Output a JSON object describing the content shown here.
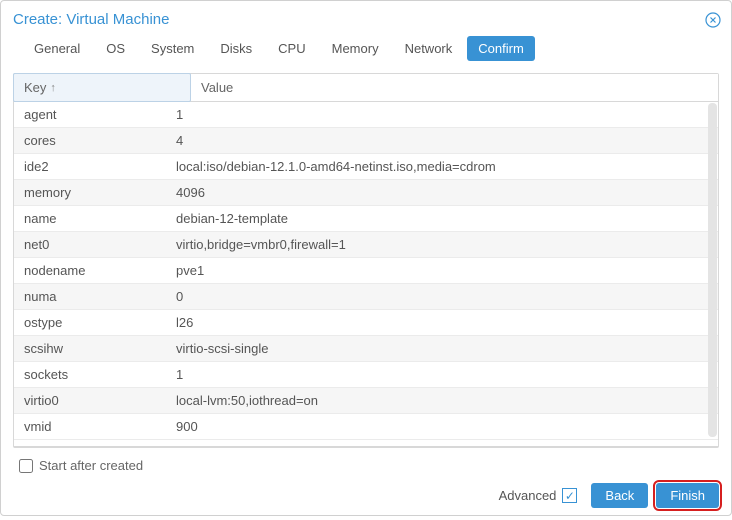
{
  "title": "Create: Virtual Machine",
  "tabs": [
    {
      "label": "General"
    },
    {
      "label": "OS"
    },
    {
      "label": "System"
    },
    {
      "label": "Disks"
    },
    {
      "label": "CPU"
    },
    {
      "label": "Memory"
    },
    {
      "label": "Network"
    },
    {
      "label": "Confirm"
    }
  ],
  "active_tab": "Confirm",
  "columns": {
    "key": "Key",
    "value": "Value"
  },
  "rows": [
    {
      "key": "agent",
      "value": "1"
    },
    {
      "key": "cores",
      "value": "4"
    },
    {
      "key": "ide2",
      "value": "local:iso/debian-12.1.0-amd64-netinst.iso,media=cdrom"
    },
    {
      "key": "memory",
      "value": "4096"
    },
    {
      "key": "name",
      "value": "debian-12-template"
    },
    {
      "key": "net0",
      "value": "virtio,bridge=vmbr0,firewall=1"
    },
    {
      "key": "nodename",
      "value": "pve1"
    },
    {
      "key": "numa",
      "value": "0"
    },
    {
      "key": "ostype",
      "value": "l26"
    },
    {
      "key": "scsihw",
      "value": "virtio-scsi-single"
    },
    {
      "key": "sockets",
      "value": "1"
    },
    {
      "key": "virtio0",
      "value": "local-lvm:50,iothread=on"
    },
    {
      "key": "vmid",
      "value": "900"
    }
  ],
  "start_after_label": "Start after created",
  "advanced_label": "Advanced",
  "back_label": "Back",
  "finish_label": "Finish"
}
